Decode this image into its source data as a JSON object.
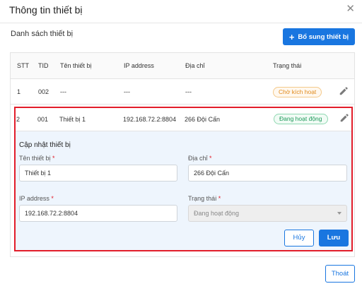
{
  "dialog": {
    "title": "Thông tin thiết bị"
  },
  "list": {
    "heading": "Danh sách thiết bị",
    "add_button_label": "Bổ sung thiết bị",
    "columns": [
      "STT",
      "TID",
      "Tên thiết bị",
      "IP address",
      "Địa chỉ",
      "Trạng thái"
    ],
    "rows": [
      {
        "stt": "1",
        "tid": "002",
        "name": "---",
        "ip": "---",
        "address": "---",
        "status": "Chờ kích hoạt"
      },
      {
        "stt": "2",
        "tid": "001",
        "name": "Thiết bị 1",
        "ip": "192.168.72.2:8804",
        "address": "266 Đội Cấn",
        "status": "Đang hoạt động"
      }
    ]
  },
  "edit_form": {
    "title": "Cập nhật thiết bị",
    "name_label": "Tên thiết bị",
    "name_value": "Thiết bị 1",
    "address_label": "Địa chỉ",
    "address_value": "266 Đội Cấn",
    "ip_label": "IP address",
    "ip_value": "192.168.72.2:8804",
    "status_label": "Trạng thái",
    "status_value": "Đang hoạt động",
    "required_mark": "*",
    "cancel_label": "Hủy",
    "save_label": "Lưu"
  },
  "footer": {
    "exit_label": "Thoát"
  },
  "colors": {
    "primary": "#1976e0",
    "highlight_border": "#e21d2a",
    "pending": "#e08a1c",
    "active": "#1d9a5a"
  }
}
